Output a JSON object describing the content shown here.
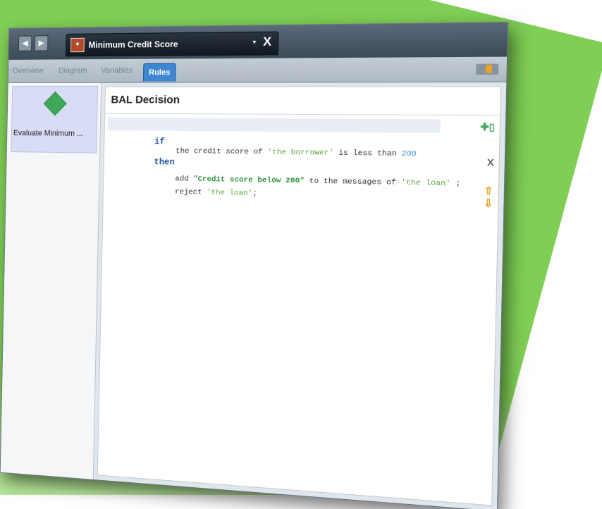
{
  "window": {
    "nav_back": "◀",
    "nav_forward": "▶",
    "doc_title": "Minimum Credit Score",
    "doc_dropdown": "▾",
    "doc_close": "X"
  },
  "tabs": [
    "Overview",
    "Diagram",
    "Variables",
    "Rules"
  ],
  "active_tab": "Rules",
  "left_panel": {
    "node_label": "Evaluate Minimum ..."
  },
  "editor": {
    "title": "BAL Decision",
    "code": {
      "if_kw": "if",
      "cond_a": "the credit score of ",
      "cond_b": "'the borrower'",
      "cond_c": " is less than ",
      "cond_num": "200",
      "then_kw": "then",
      "act1_a": "add ",
      "act1_str": "\"Credit score below 200\"",
      "act1_b": " to the messages of ",
      "act1_lit": "'the loan'",
      "act1_c": " ;",
      "act2_a": "reject ",
      "act2_lit": "'the loan'",
      "act2_b": ";"
    },
    "side_icons": [
      "add-condition-icon",
      "delete-icon",
      "move-up-icon",
      "move-down-icon"
    ],
    "delete_glyph": "X"
  },
  "colors": {
    "background_green": "#7fcf55",
    "active_tab": "#3d86d0",
    "keyword": "#1a4fa0",
    "literal": "#5aa63d"
  }
}
